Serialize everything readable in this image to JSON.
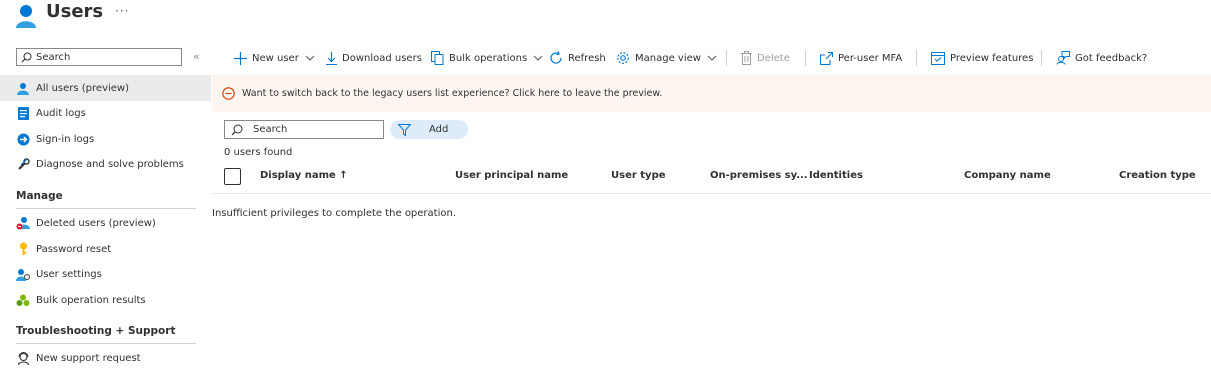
{
  "page": {
    "title": "Users",
    "more_label": "···"
  },
  "sidebar": {
    "search_placeholder": "Search",
    "collapse_label": "«",
    "items": [
      {
        "label": "All users (preview)"
      },
      {
        "label": "Audit logs"
      },
      {
        "label": "Sign-in logs"
      },
      {
        "label": "Diagnose and solve problems"
      }
    ],
    "sections": [
      {
        "title": "Manage",
        "items": [
          {
            "label": "Deleted users (preview)"
          },
          {
            "label": "Password reset"
          },
          {
            "label": "User settings"
          },
          {
            "label": "Bulk operation results"
          }
        ]
      },
      {
        "title": "Troubleshooting + Support",
        "items": [
          {
            "label": "New support request"
          }
        ]
      }
    ]
  },
  "toolbar": {
    "new_user": "New user",
    "download_users": "Download users",
    "bulk_operations": "Bulk operations",
    "refresh": "Refresh",
    "manage_view": "Manage view",
    "delete": "Delete",
    "per_user_mfa": "Per-user MFA",
    "preview_features": "Preview features",
    "got_feedback": "Got feedback?"
  },
  "banner": {
    "text": "Want to switch back to the legacy users list experience? Click here to leave the preview."
  },
  "filters": {
    "search_placeholder": "Search",
    "add_label": "Add"
  },
  "results": {
    "count_text": "0 users found"
  },
  "table": {
    "columns": [
      {
        "label": "Display name ↑"
      },
      {
        "label": "User principal name"
      },
      {
        "label": "User type"
      },
      {
        "label": "On-premises sy..."
      },
      {
        "label": "Identities"
      },
      {
        "label": "Company name"
      },
      {
        "label": "Creation type"
      }
    ]
  },
  "error": {
    "text": "Insufficient privileges to complete the operation."
  },
  "icons": {
    "header": "user-icon",
    "accent": "#0078d4",
    "warning": "#d83b01"
  }
}
